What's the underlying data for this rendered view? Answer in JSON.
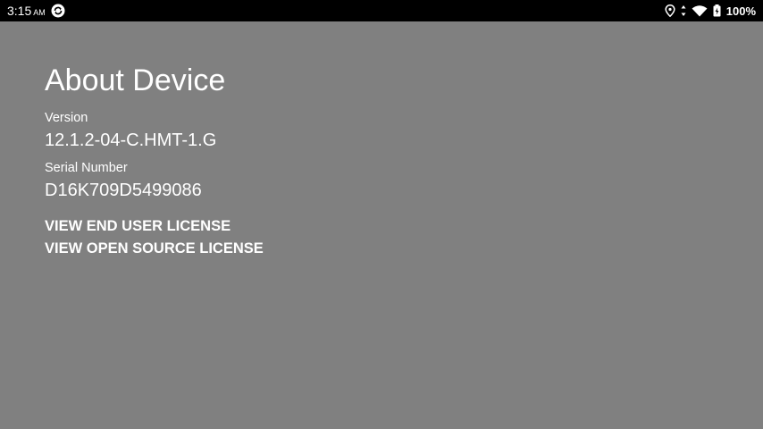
{
  "status_bar": {
    "time": "3:15",
    "time_suffix": "AM",
    "battery_percent": "100%",
    "icons": [
      "sync-icon",
      "location-icon",
      "data-arrows-icon",
      "wifi-icon",
      "battery-icon"
    ]
  },
  "about": {
    "title": "About Device",
    "version_label": "Version",
    "version_value": "12.1.2-04-C.HMT-1.G",
    "serial_label": "Serial Number",
    "serial_value": "D16K709D5499086"
  },
  "links": {
    "eula": "VIEW END USER LICENSE",
    "open_source": "VIEW OPEN SOURCE LICENSE"
  },
  "colors": {
    "background": "#808080",
    "status_bar": "#000000",
    "text": "#ffffff"
  }
}
